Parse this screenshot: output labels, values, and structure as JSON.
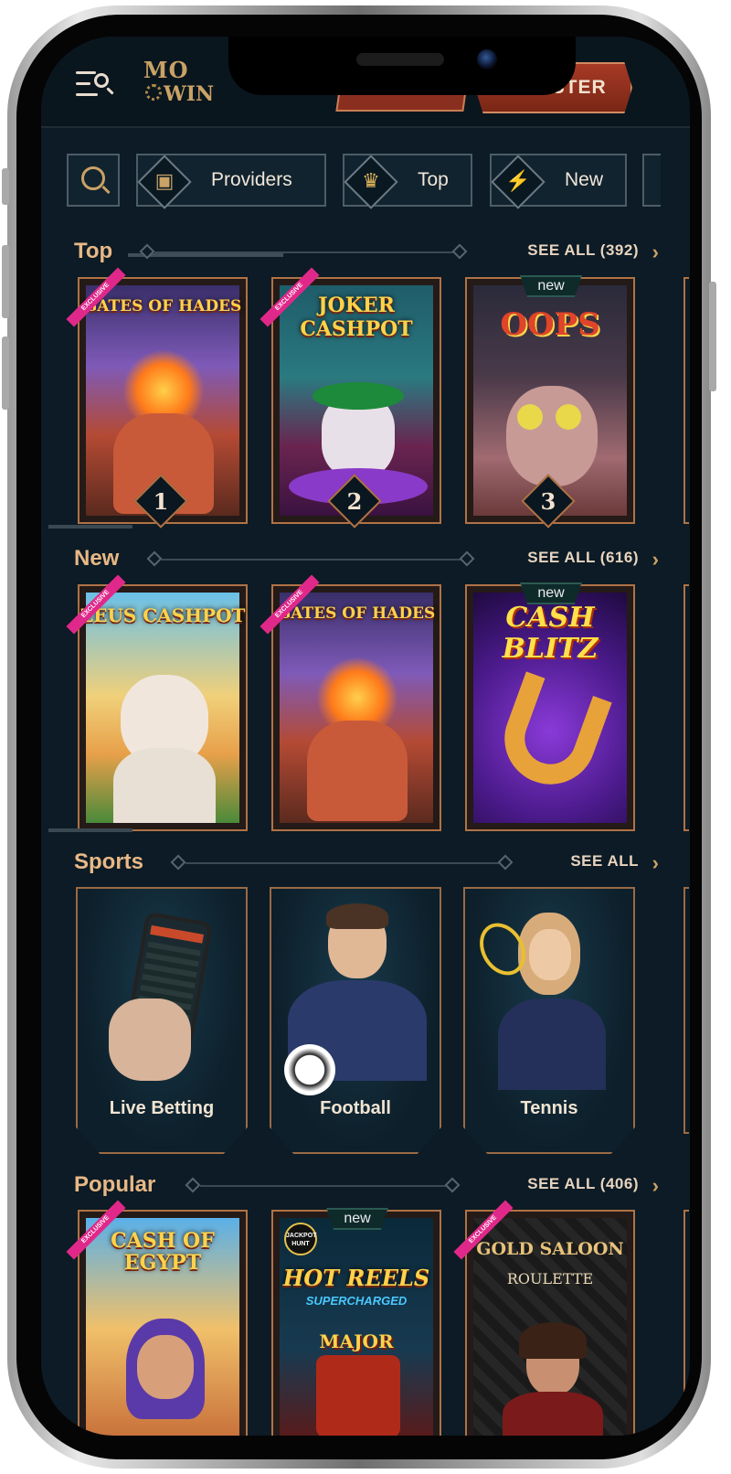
{
  "header": {
    "logo_line1": "MO",
    "logo_line2": "WIN",
    "register_label": "REGISTER"
  },
  "filters": [
    {
      "label": "Providers",
      "icon": "book-icon"
    },
    {
      "label": "Top",
      "icon": "crown-icon"
    },
    {
      "label": "New",
      "icon": "lightning-icon"
    }
  ],
  "sections": {
    "top": {
      "title": "Top",
      "see_all": "SEE ALL (392)",
      "games": [
        {
          "title": "GATES OF HADES",
          "badge": "EXCLUSIVE",
          "rank": "1"
        },
        {
          "title": "JOKER CASHPOT",
          "badge": "EXCLUSIVE",
          "rank": "2"
        },
        {
          "title": "OOPS",
          "tag": "new",
          "rank": "3"
        }
      ]
    },
    "new": {
      "title": "New",
      "see_all": "SEE ALL (616)",
      "games": [
        {
          "title": "ZEUS CASHPOT",
          "badge": "EXCLUSIVE"
        },
        {
          "title": "GATES OF HADES",
          "badge": "EXCLUSIVE"
        },
        {
          "title": "CASH BLITZ",
          "tag": "new"
        }
      ]
    },
    "sports": {
      "title": "Sports",
      "see_all": "SEE ALL",
      "items": [
        {
          "label": "Live Betting"
        },
        {
          "label": "Football"
        },
        {
          "label": "Tennis"
        }
      ]
    },
    "popular": {
      "title": "Popular",
      "see_all": "SEE ALL (406)",
      "games": [
        {
          "title": "CASH OF EGYPT",
          "badge": "EXCLUSIVE"
        },
        {
          "title": "HOT REELS",
          "subtitle": "SUPERCHARGED",
          "extra": "MAJOR",
          "corner": "JACKPOT HUNT",
          "tag": "new"
        },
        {
          "title": "GOLD SALOON",
          "subtitle": "ROULETTE",
          "badge": "EXCLUSIVE"
        }
      ]
    }
  },
  "colors": {
    "background": "#0c1b25",
    "accent_gold": "#e8b886",
    "card_border": "#b07245",
    "register": "#a63a25",
    "exclusive_badge": "#e0288a"
  }
}
